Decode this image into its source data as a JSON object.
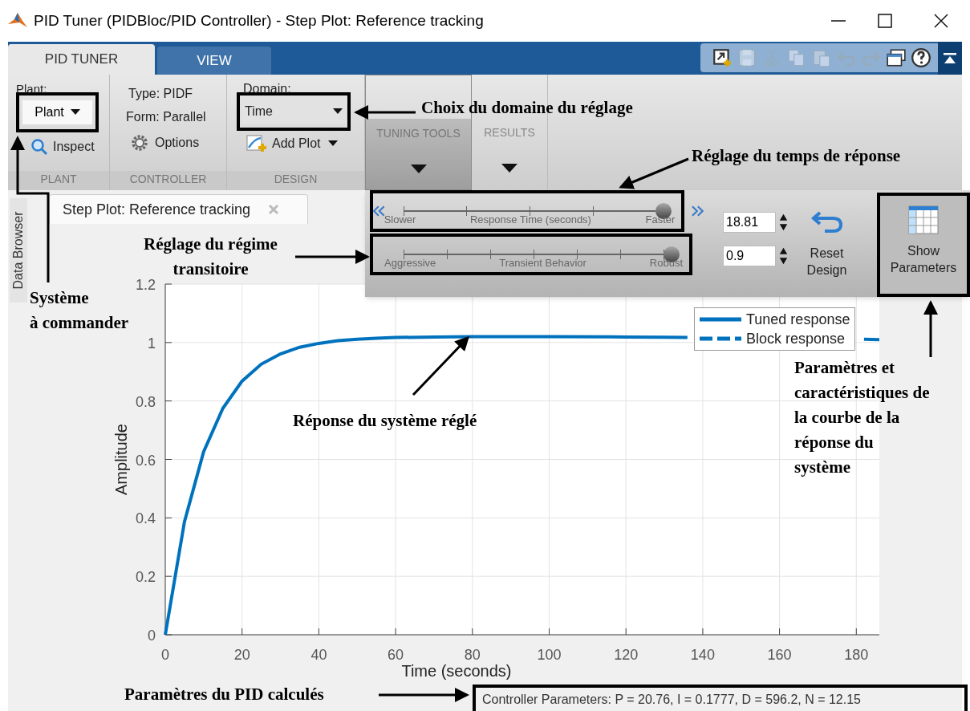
{
  "window": {
    "title": "PID Tuner (PIDBloc/PID Controller) - Step Plot: Reference tracking"
  },
  "ribbon_tabs": [
    {
      "label": "PID TUNER",
      "selected": true
    },
    {
      "label": "VIEW",
      "selected": false
    }
  ],
  "quick_access": [
    {
      "kind": "new",
      "disabled": false
    },
    {
      "kind": "save",
      "disabled": true
    },
    {
      "kind": "cut",
      "disabled": true
    },
    {
      "kind": "copy",
      "disabled": true
    },
    {
      "kind": "paste",
      "disabled": true
    },
    {
      "kind": "undo",
      "disabled": true
    },
    {
      "kind": "redo",
      "disabled": true
    },
    {
      "kind": "layout",
      "disabled": false
    },
    {
      "kind": "help",
      "disabled": false
    }
  ],
  "plant": {
    "label": "Plant:",
    "dropdown": "Plant",
    "inspect": "Inspect",
    "section": "PLANT"
  },
  "controller": {
    "type": "Type: PIDF",
    "form": "Form: Parallel",
    "options": "Options",
    "section": "CONTROLLER"
  },
  "design": {
    "label": "Domain:",
    "dropdown": "Time",
    "add_plot": "Add Plot",
    "section": "DESIGN"
  },
  "tool_buttons": [
    {
      "label": "TUNING TOOLS",
      "selected": true
    },
    {
      "label": "RESULTS",
      "selected": false
    }
  ],
  "tuning": {
    "sliders": [
      {
        "left": "Slower",
        "caption": "Response Time (seconds)",
        "right": "Faster",
        "level": 1,
        "value": "18.81"
      },
      {
        "left": "Aggressive",
        "caption": "Transient Behavior",
        "right": "Robust",
        "level": 1,
        "value": "0.9"
      }
    ],
    "reset": "Reset Design",
    "show": "Show Parameters"
  },
  "side_tab": "Data Browser",
  "document_tab": "Step Plot: Reference tracking",
  "plot": {
    "chart_data": {
      "type": "line",
      "xlabel": "Time (seconds)",
      "ylabel": "Amplitude",
      "x": [
        0,
        5,
        10,
        15,
        20,
        25,
        30,
        35,
        40,
        45,
        50,
        55,
        60,
        70,
        80,
        100,
        120,
        130,
        136,
        140,
        160,
        180,
        182,
        186
      ],
      "series": [
        {
          "name": "Tuned response",
          "color": "#0072bd",
          "line_style": "solid",
          "values": [
            0,
            0.387,
            0.626,
            0.775,
            0.868,
            0.926,
            0.961,
            0.984,
            0.997,
            1.006,
            1.011,
            1.015,
            1.017,
            1.019,
            1.02,
            1.02,
            1.019,
            1.018,
            1.017,
            null,
            null,
            null,
            1.011,
            1.01
          ]
        },
        {
          "name": "Block response",
          "line_style": "dashed",
          "values": [
            null,
            null,
            null,
            null,
            null,
            null,
            null,
            null,
            null,
            null,
            null,
            null,
            null,
            null,
            null,
            null,
            null,
            null,
            null,
            null,
            null,
            null,
            null,
            null
          ]
        }
      ],
      "grid": true,
      "legend": true,
      "xlim": [
        0,
        186
      ],
      "ylim": [
        0,
        1.2
      ],
      "xticks": [
        0,
        20,
        40,
        60,
        80,
        100,
        120,
        140,
        160,
        180
      ],
      "yticks": [
        0,
        0.2,
        0.4,
        0.6,
        0.8,
        1,
        1.2
      ]
    }
  },
  "status": "Controller Parameters: P = 20.76, I = 0.1777, D = 596.2, N = 12.15",
  "annotations": [
    "Choix du domaine du réglage",
    "Réglage du temps de réponse",
    "Réglage du régime\ntransitoire",
    "Système\nà commander",
    "Réponse du système réglé",
    "Paramètres et\ncaractéristiques de\nla courbe de la\nréponse du\nsystème",
    "Paramètres du PID calculés"
  ]
}
